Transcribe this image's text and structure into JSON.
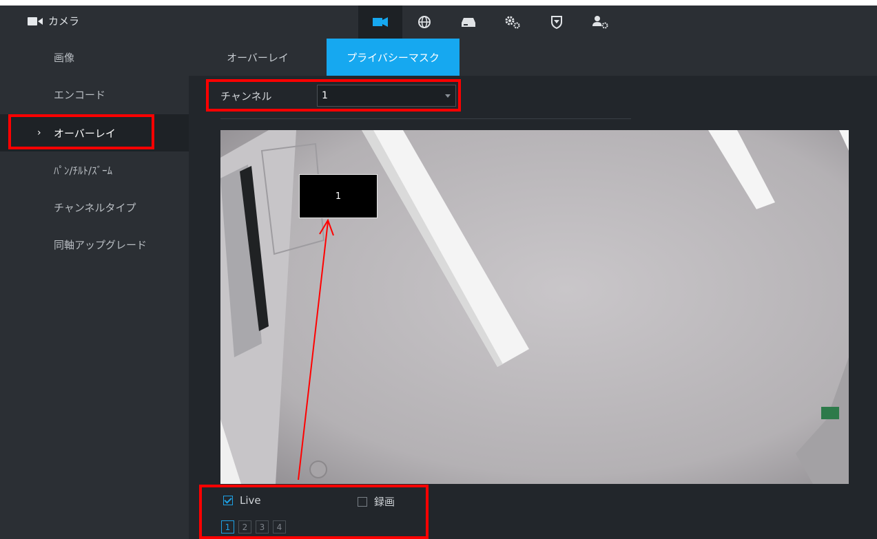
{
  "app": {
    "title": "カメラ"
  },
  "topnav": {
    "icons": [
      "camera-icon",
      "network-globe-icon",
      "storage-hdd-icon",
      "system-gears-icon",
      "security-shield-icon",
      "account-user-icon"
    ],
    "active_index": 0
  },
  "sidebar": {
    "items": [
      {
        "label": "画像"
      },
      {
        "label": "エンコード"
      },
      {
        "label": "オーバーレイ",
        "active": true,
        "chevron": "›"
      },
      {
        "label": "ﾊﾟﾝ/ﾁﾙﾄ/ｽﾞｰﾑ"
      },
      {
        "label": "チャンネルタイプ"
      },
      {
        "label": "同軸アップグレード"
      }
    ]
  },
  "tabs": [
    {
      "label": "オーバーレイ"
    },
    {
      "label": "プライバシーマスク",
      "active": true
    }
  ],
  "channel": {
    "label": "チャンネル",
    "value": "1"
  },
  "mask": {
    "label": "1"
  },
  "options": {
    "live": {
      "label": "Live",
      "checked": true
    },
    "record": {
      "label": "録画",
      "checked": false
    }
  },
  "mask_regions": {
    "buttons": [
      "1",
      "2",
      "3",
      "4"
    ],
    "selected": "1"
  },
  "colors": {
    "accent": "#16a8f0",
    "highlight": "#ff0000",
    "sidebar_bg": "#2b2f34",
    "main_bg": "#22262b"
  }
}
